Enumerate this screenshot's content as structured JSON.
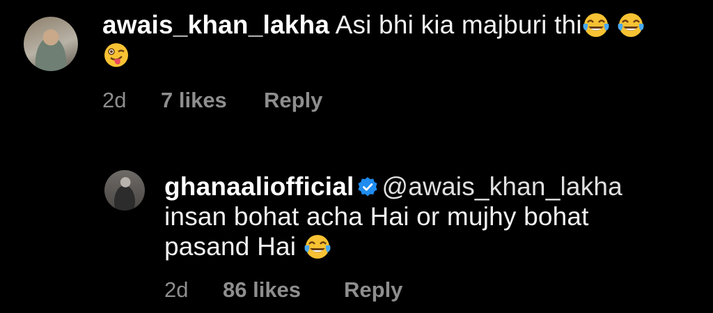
{
  "comments": [
    {
      "username": "awais_khan_lakha",
      "text": "Asi bhi kia majburi thi",
      "emojis": [
        "face-with-tears-of-joy",
        "face-with-tears-of-joy",
        "winking-face-with-tongue"
      ],
      "timestamp": "2d",
      "likes": "7 likes",
      "reply_label": "Reply"
    },
    {
      "username": "ghanaaliofficial",
      "verified": true,
      "mention": "@awais_khan_lakha",
      "text": "insan bohat acha Hai or mujhy bohat pasand Hai",
      "emojis": [
        "face-with-tears-of-joy"
      ],
      "timestamp": "2d",
      "likes": "86 likes",
      "reply_label": "Reply"
    }
  ],
  "colors": {
    "background": "#000000",
    "text": "#f5f5f5",
    "meta": "#8e8e8e",
    "verified_badge": "#1f8cf0"
  }
}
